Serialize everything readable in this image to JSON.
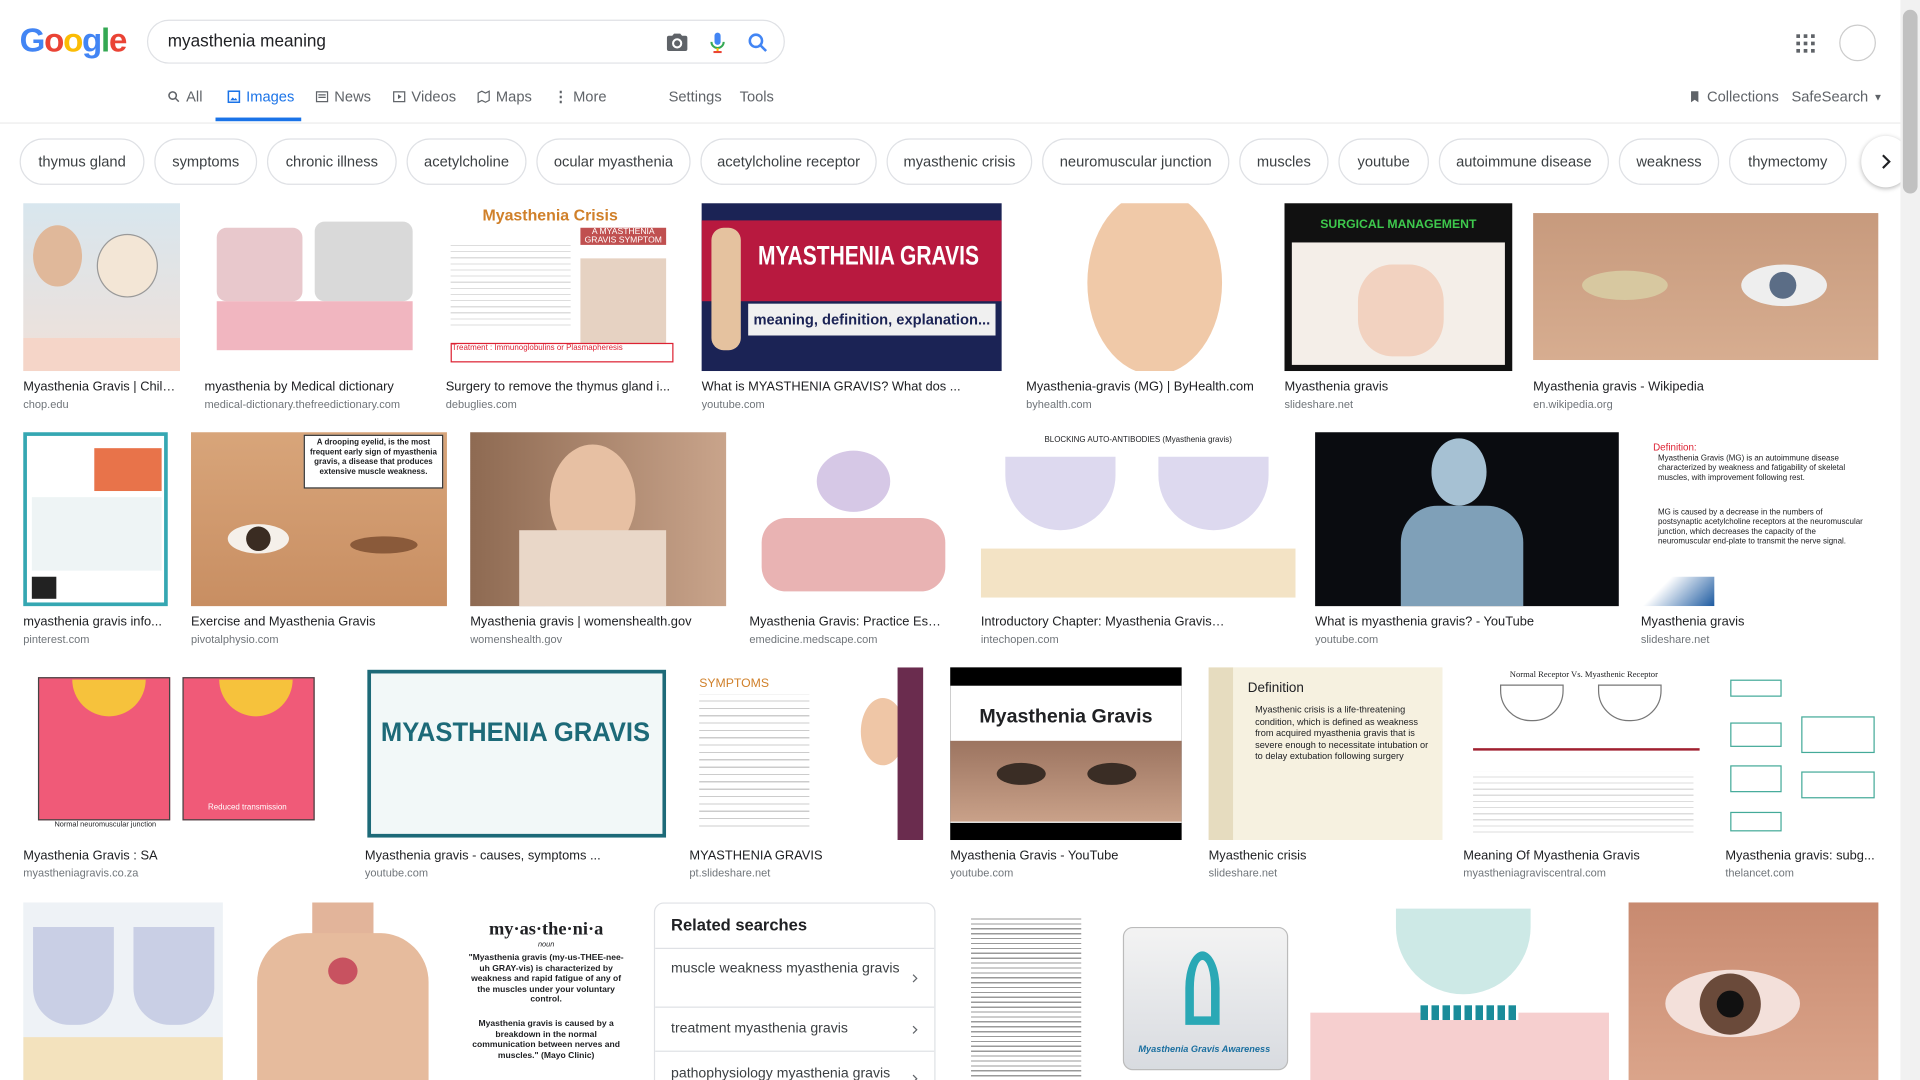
{
  "logo": {
    "letters": [
      "G",
      "o",
      "o",
      "g",
      "l",
      "e"
    ],
    "colors": [
      "#4285f4",
      "#ea4335",
      "#fbbc05",
      "#4285f4",
      "#34a853",
      "#ea4335"
    ]
  },
  "search": {
    "query": "myasthenia meaning"
  },
  "tabs": [
    {
      "label": "All",
      "icon": "search-icon"
    },
    {
      "label": "Images",
      "icon": "image-icon",
      "active": true
    },
    {
      "label": "News",
      "icon": "news-icon"
    },
    {
      "label": "Videos",
      "icon": "video-icon"
    },
    {
      "label": "Maps",
      "icon": "map-icon"
    },
    {
      "label": "More",
      "icon": "more-vert-icon"
    },
    {
      "label": "Settings"
    },
    {
      "label": "Tools"
    }
  ],
  "right_tools": {
    "collections": "Collections",
    "safesearch": "SafeSearch"
  },
  "chips": [
    "thymus gland",
    "symptoms",
    "chronic illness",
    "acetylcholine",
    "ocular myasthenia",
    "acetylcholine receptor",
    "myasthenic crisis",
    "neuromuscular junction",
    "muscles",
    "youtube",
    "autoimmune disease",
    "weakness",
    "thymectomy"
  ],
  "results": {
    "row1": [
      {
        "caption": "Myasthenia Gravis | Child...",
        "source": "chop.edu"
      },
      {
        "caption": "myasthenia by Medical dictionary",
        "source": "medical-dictionary.thefreedictionary.com"
      },
      {
        "caption": "Surgery to remove the thymus gland i...",
        "source": "debuglies.com"
      },
      {
        "caption": "What is MYASTHENIA GRAVIS? What dos ...",
        "source": "youtube.com"
      },
      {
        "caption": "Myasthenia-gravis (MG) | ByHealth.com",
        "source": "byhealth.com"
      },
      {
        "caption": "Myasthenia gravis",
        "source": "slideshare.net"
      },
      {
        "caption": "Myasthenia gravis - Wikipedia",
        "source": "en.wikipedia.org"
      }
    ],
    "row2": [
      {
        "caption": "myasthenia gravis info...",
        "source": "pinterest.com"
      },
      {
        "caption": "Exercise and Myasthenia Gravis",
        "source": "pivotalphysio.com"
      },
      {
        "caption": "Myasthenia gravis | womenshealth.gov",
        "source": "womenshealth.gov"
      },
      {
        "caption": "Myasthenia Gravis: Practice Esse...",
        "source": "emedicine.medscape.com"
      },
      {
        "caption": "Introductory Chapter: Myasthenia Gravis ...",
        "source": "intechopen.com"
      },
      {
        "caption": "What is myasthenia gravis? - YouTube",
        "source": "youtube.com"
      },
      {
        "caption": "Myasthenia gravis",
        "source": "slideshare.net"
      }
    ],
    "row3": [
      {
        "caption": "Myasthenia Gravis : SA",
        "source": "myastheniagravis.co.za"
      },
      {
        "caption": "Myasthenia gravis - causes, symptoms ...",
        "source": "youtube.com"
      },
      {
        "caption": "MYASTHENIA GRAVIS",
        "source": "pt.slideshare.net"
      },
      {
        "caption": "Myasthenia Gravis - YouTube",
        "source": "youtube.com"
      },
      {
        "caption": "Myasthenic crisis",
        "source": "slideshare.net"
      },
      {
        "caption": "Meaning Of Myasthenia Gravis",
        "source": "myastheniagraviscentral.com"
      },
      {
        "caption": "Myasthenia gravis: subg...",
        "source": "thelancet.com"
      }
    ]
  },
  "thumb_text": {
    "crisis_title": "Myasthenia Crisis",
    "crisis_sub": "A MYASTHENIA GRAVIS SYMPTOM",
    "crisis_treat": "Treatment : Immunoglobulins or Plasmapheresis",
    "yt_title": "MYASTHENIA GRAVIS",
    "yt_sub": "meaning, definition, explanation...",
    "surgical": "SURGICAL MANAGEMENT",
    "droop": "A drooping eyelid, is the most frequent early sign of myasthenia gravis, a disease that produces extensive muscle weakness.",
    "blocking": "BLOCKING AUTO-ANTIBODIES (Myasthenia gravis)",
    "def_title": "Definition:",
    "def_body": "Myasthenia Gravis (MG) is an autoimmune disease characterized by weakness and fatigability of skeletal muscles, with improvement following rest.",
    "def_body2": "MG is caused by a decrease in the numbers of postsynaptic acetylcholine receptors at the neuromuscular junction, which decreases the capacity of the neuromuscular end-plate to transmit the nerve signal.",
    "mg_big": "MYASTHENIA GRAVIS",
    "symptoms": "SYMPTOMS",
    "mg_yt": "Myasthenia Gravis",
    "crisis_def_title": "Definition",
    "crisis_def": "Myasthenic crisis is a life-threatening condition, which is defined as weakness from acquired myasthenia gravis that is severe enough to necessitate intubation or to delay extubation following surgery",
    "normal_vs": "Normal Receptor Vs. Myasthenic Receptor",
    "normal_nmj": "Normal neuromuscular junction",
    "reduced": "Reduced transmission",
    "dict_word": "my·as·the·ni·a",
    "dict_pos": "noun",
    "dict_quote": "\"Myasthenia gravis (my-us-THEE-nee-uh GRAY-vis) is characterized by weakness and rapid fatigue of any of the muscles under your voluntary control.",
    "dict_quote2": "Myasthenia gravis is caused by a breakdown in the normal communication between nerves and muscles.\" (Mayo Clinic)",
    "awareness": "Myasthenia Gravis Awareness"
  },
  "related": {
    "title": "Related searches",
    "items": [
      "muscle weakness myasthenia gravis",
      "treatment myasthenia gravis",
      "pathophysiology myasthenia gravis"
    ]
  }
}
